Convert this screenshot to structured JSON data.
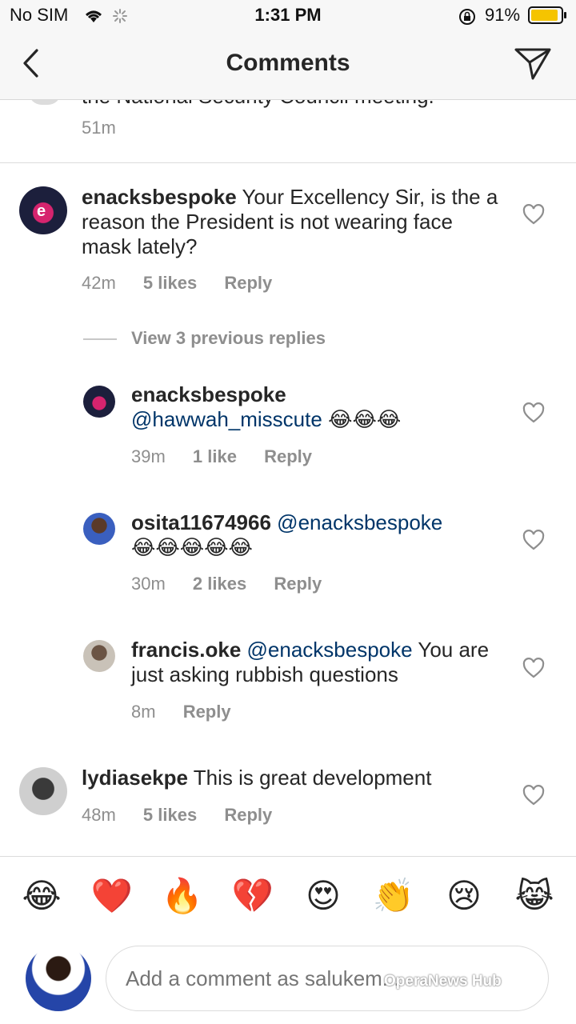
{
  "status": {
    "carrier": "No SIM",
    "time": "1:31 PM",
    "battery": "91%",
    "battery_level": 0.91
  },
  "nav": {
    "title": "Comments"
  },
  "partial": {
    "text": "the National Security Council meeting.",
    "time": "51m"
  },
  "comments": [
    {
      "user": "enacksbespoke",
      "text": "Your Excellency Sir, is the a reason the President is not wearing face mask lately?",
      "time": "42m",
      "likes": "5 likes",
      "reply": "Reply"
    },
    {
      "user": "lydiasekpe",
      "text": "This is great development",
      "time": "48m",
      "likes": "5 likes",
      "reply": "Reply"
    }
  ],
  "view_replies": "View 3 previous replies",
  "replies": [
    {
      "user": "enacksbespoke",
      "mention": "@hawwah_misscute",
      "text": "😂😂😂",
      "time": "39m",
      "likes": "1 like",
      "reply": "Reply"
    },
    {
      "user": "osita11674966",
      "mention": "@enacksbespoke",
      "text": "😂😂😂😂😂",
      "time": "30m",
      "likes": "2 likes",
      "reply": "Reply"
    },
    {
      "user": "francis.oke",
      "mention": "@enacksbespoke",
      "text": "You are just asking rubbish questions",
      "time": "8m",
      "reply": "Reply"
    }
  ],
  "emoji_bar": [
    "😂",
    "❤️",
    "🔥",
    "💔",
    "😍",
    "👏",
    "😢",
    "😹"
  ],
  "composer": {
    "placeholder": "Add a comment as salukem..."
  },
  "watermark": "OperaNews Hub",
  "icons": {
    "back": "chevron-left-icon",
    "send": "paper-plane-icon",
    "like": "heart-outline-icon",
    "wifi": "wifi-icon",
    "lock": "rotation-lock-icon"
  },
  "colors": {
    "mention": "#003569",
    "meta": "#8e8e8e",
    "battery": "#f5c400"
  }
}
